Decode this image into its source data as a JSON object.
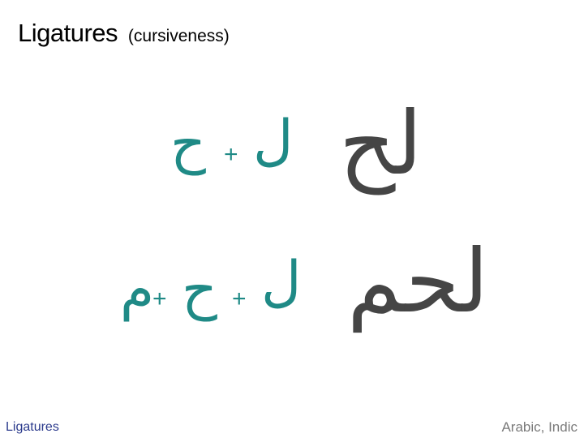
{
  "slide": {
    "title": "Ligatures",
    "subtitle": "(cursiveness)"
  },
  "rows": [
    {
      "components": [
        "ل",
        "ح"
      ],
      "operator": "+",
      "ligature": "لح"
    },
    {
      "components": [
        "ل",
        "ح",
        "م"
      ],
      "operator": "+",
      "ligature": "لحم"
    }
  ],
  "footer": {
    "left": "Ligatures",
    "right": "Arabic, Indic"
  },
  "colors": {
    "component_glyph": "#1f8a86",
    "ligature_glyph": "#454545",
    "footer_left": "#2b3a8c",
    "footer_right": "#7a7a7a"
  }
}
